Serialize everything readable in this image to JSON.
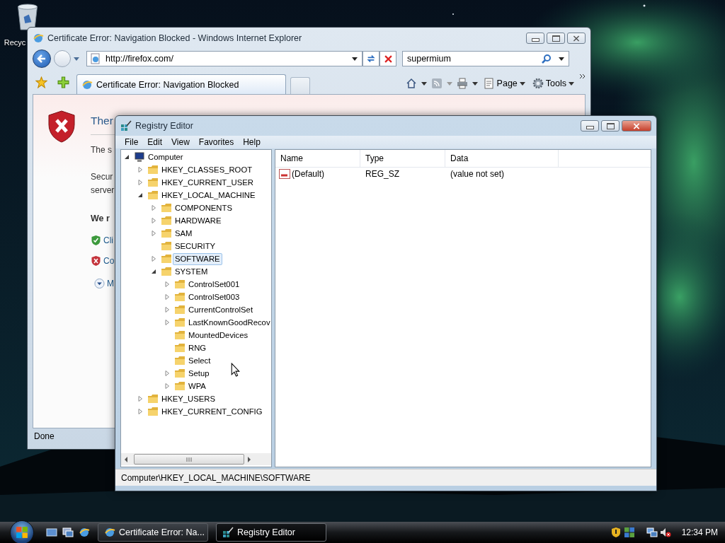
{
  "desktop": {
    "icons": [
      {
        "label": "Recyc"
      }
    ]
  },
  "browser": {
    "title": "Certificate Error: Navigation Blocked - Windows Internet Explorer",
    "address": "http://firefox.com/",
    "search": "supermium",
    "tab": {
      "label": "Certificate Error: Navigation Blocked"
    },
    "toolbar": [
      {
        "kind": "page",
        "label": "Page"
      },
      {
        "kind": "tools",
        "label": "Tools"
      }
    ],
    "content": {
      "heading": "Ther",
      "lines": [
        {
          "kind": "text",
          "text": "The s"
        },
        {
          "kind": "gap",
          "text": "Secur"
        },
        {
          "kind": "text",
          "text": "server"
        },
        {
          "kind": "bold",
          "text": "We r"
        },
        {
          "kind": "ok",
          "text": "Cli"
        },
        {
          "kind": "bad",
          "text": "Co"
        },
        {
          "kind": "more",
          "text": "M"
        }
      ]
    },
    "status": "Done"
  },
  "registry": {
    "title": "Registry Editor",
    "menu": [
      "File",
      "Edit",
      "View",
      "Favorites",
      "Help"
    ],
    "tree": [
      {
        "label": "Computer",
        "selected": false,
        "expanded": true,
        "children": [
          {
            "label": "HKEY_CLASSES_ROOT",
            "selected": false,
            "expanded": false
          },
          {
            "label": "HKEY_CURRENT_USER",
            "selected": false,
            "expanded": false
          },
          {
            "label": "HKEY_LOCAL_MACHINE",
            "selected": false,
            "expanded": true,
            "children": [
              {
                "label": "COMPONENTS",
                "selected": false,
                "expanded": false
              },
              {
                "label": "HARDWARE",
                "selected": false,
                "expanded": false
              },
              {
                "label": "SAM",
                "selected": false,
                "expanded": false
              },
              {
                "label": "SECURITY",
                "selected": false
              },
              {
                "label": "SOFTWARE",
                "selected": true,
                "expanded": false
              },
              {
                "label": "SYSTEM",
                "selected": false,
                "expanded": true,
                "children": [
                  {
                    "label": "ControlSet001",
                    "selected": false,
                    "expanded": false
                  },
                  {
                    "label": "ControlSet003",
                    "selected": false,
                    "expanded": false
                  },
                  {
                    "label": "CurrentControlSet",
                    "selected": false,
                    "expanded": false
                  },
                  {
                    "label": "LastKnownGoodRecov",
                    "selected": false,
                    "expanded": false
                  },
                  {
                    "label": "MountedDevices",
                    "selected": false
                  },
                  {
                    "label": "RNG",
                    "selected": false
                  },
                  {
                    "label": "Select",
                    "selected": false
                  },
                  {
                    "label": "Setup",
                    "selected": false,
                    "expanded": false
                  },
                  {
                    "label": "WPA",
                    "selected": false,
                    "expanded": false
                  }
                ]
              }
            ]
          },
          {
            "label": "HKEY_USERS",
            "selected": false,
            "expanded": false
          },
          {
            "label": "HKEY_CURRENT_CONFIG",
            "selected": false,
            "expanded": false
          }
        ]
      }
    ],
    "columns": [
      "Name",
      "Type",
      "Data"
    ],
    "rows": [
      {
        "name": "(Default)",
        "type": "REG_SZ",
        "data": "(value not set)"
      }
    ],
    "status": "Computer\\HKEY_LOCAL_MACHINE\\SOFTWARE"
  },
  "taskbar": {
    "tasks": [
      {
        "kind": "browser",
        "label": "Certificate Error: Na...",
        "selected": false
      },
      {
        "kind": "registry",
        "label": "Registry Editor",
        "selected": true
      }
    ],
    "clock": "12:34 PM"
  }
}
